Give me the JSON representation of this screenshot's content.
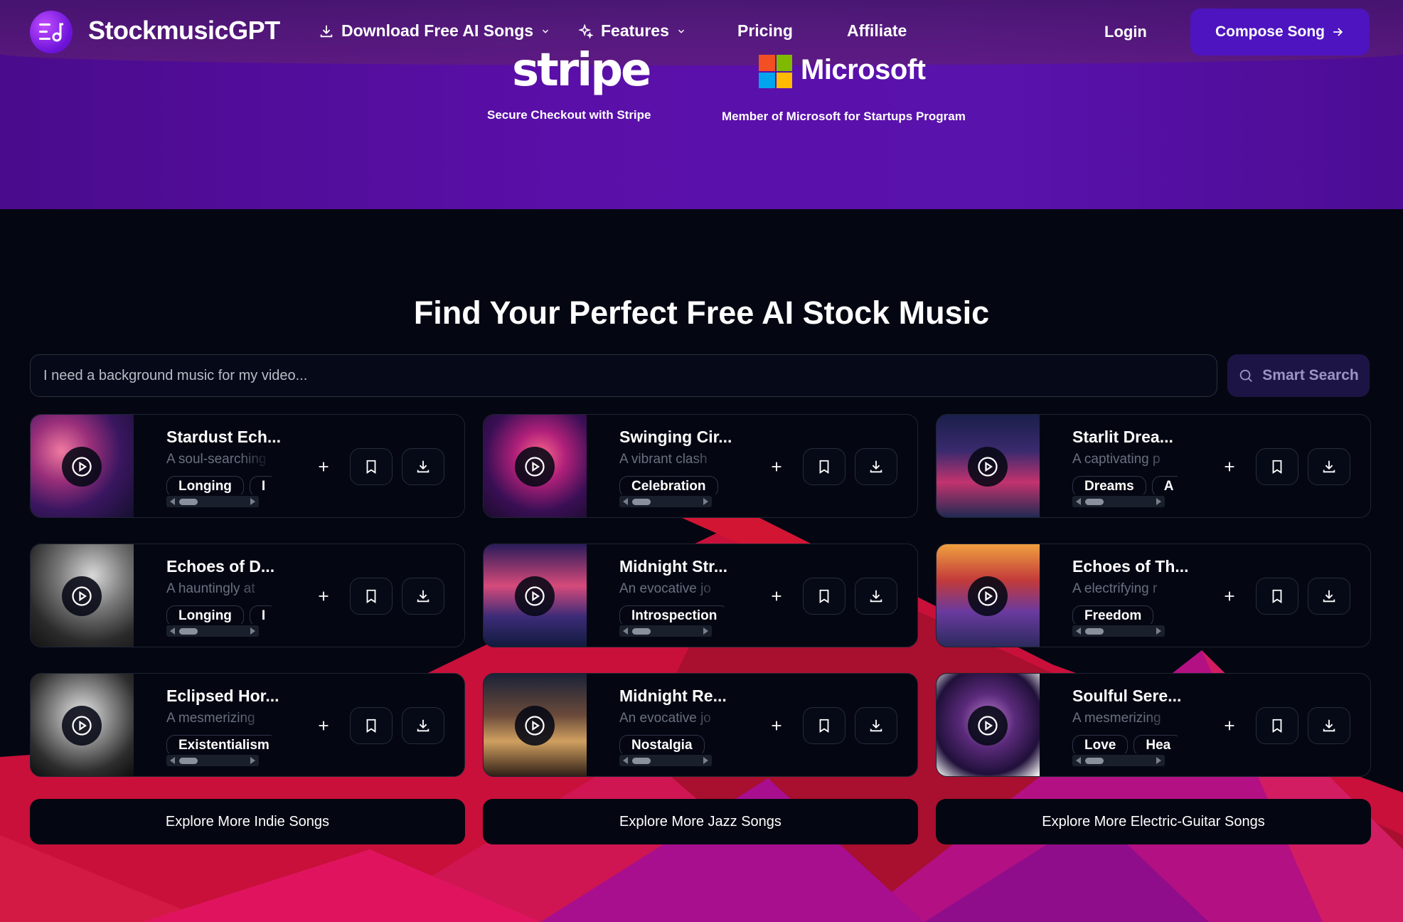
{
  "nav": {
    "brand": "StockmusicGPT",
    "download_label": "Download Free AI Songs",
    "features_label": "Features",
    "pricing_label": "Pricing",
    "affiliate_label": "Affiliate",
    "login_label": "Login",
    "compose_label": "Compose Song"
  },
  "partners": {
    "stripe_logo": "stripe",
    "stripe_caption": "Secure Checkout with Stripe",
    "microsoft_logo": "Microsoft",
    "microsoft_caption": "Member of Microsoft for Startups Program"
  },
  "main": {
    "heading": "Find Your Perfect Free AI Stock Music",
    "search_placeholder": "I need a background music for my video...",
    "search_button": "Smart Search"
  },
  "songs": [
    {
      "title": "Stardust Ech...",
      "desc": "A soul-searching",
      "tags": [
        "Longing",
        "I"
      ]
    },
    {
      "title": "Swinging Cir...",
      "desc": "A vibrant clash",
      "tags": [
        "Celebration"
      ]
    },
    {
      "title": "Starlit Drea...",
      "desc": "A captivating p",
      "tags": [
        "Dreams",
        "A"
      ]
    },
    {
      "title": "Echoes of D...",
      "desc": "A hauntingly at",
      "tags": [
        "Longing",
        "I"
      ]
    },
    {
      "title": "Midnight Str...",
      "desc": "An evocative jo",
      "tags": [
        "Introspection"
      ]
    },
    {
      "title": "Echoes of Th...",
      "desc": "A electrifying r",
      "tags": [
        "Freedom"
      ]
    },
    {
      "title": "Eclipsed Hor...",
      "desc": "A mesmerizing",
      "tags": [
        "Existentialism"
      ]
    },
    {
      "title": "Midnight Re...",
      "desc": "An evocative jo",
      "tags": [
        "Nostalgia"
      ]
    },
    {
      "title": "Soulful Sere...",
      "desc": "A mesmerizing",
      "tags": [
        "Love",
        "Hea"
      ]
    }
  ],
  "explore": {
    "indie": "Explore More Indie Songs",
    "jazz": "Explore More Jazz Songs",
    "guitar": "Explore More Electric-Guitar Songs"
  },
  "colors": {
    "hero_purple": "#5a0fa8",
    "compose_button": "#4d14bf",
    "page_dark": "#040712",
    "mountain_red": "#d3163a",
    "mountain_magenta": "#b8129a"
  }
}
